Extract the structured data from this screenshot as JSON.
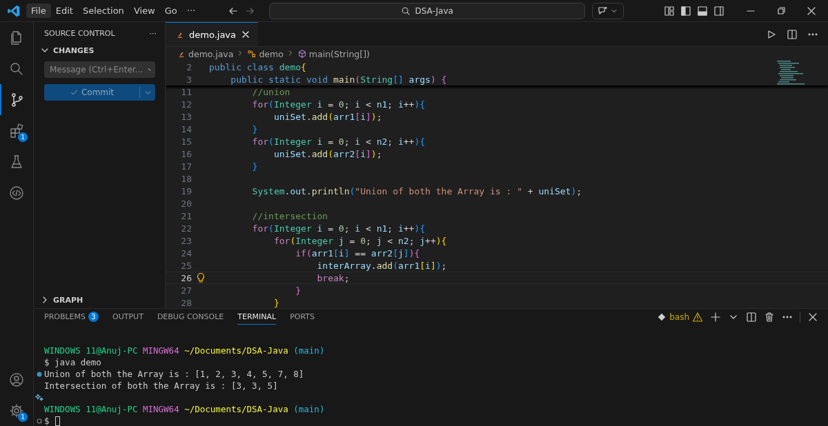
{
  "title_bar": {
    "menu": [
      {
        "label": "File",
        "selected": true
      },
      {
        "label": "Edit",
        "selected": false
      },
      {
        "label": "Selection",
        "selected": false
      },
      {
        "label": "View",
        "selected": false
      },
      {
        "label": "Go",
        "selected": false
      }
    ],
    "more": "···",
    "search": "DSA-Java"
  },
  "activity_bar": {
    "top": [
      {
        "kind": "files",
        "selected": false
      },
      {
        "kind": "search",
        "selected": false
      },
      {
        "kind": "source-control",
        "selected": true
      },
      {
        "kind": "extensions",
        "selected": false,
        "badge": "1"
      },
      {
        "kind": "flask",
        "selected": false
      },
      {
        "kind": "code",
        "selected": false
      }
    ],
    "bottom": [
      {
        "kind": "account",
        "selected": false
      },
      {
        "kind": "gear",
        "selected": false,
        "badge": "1"
      }
    ]
  },
  "sidebar": {
    "title": "SOURCE CONTROL",
    "more": "···",
    "section": "CHANGES",
    "message_placeholder": "Message (Ctrl+Enter...",
    "commit_label": "Commit",
    "graph": "GRAPH"
  },
  "editor": {
    "tab": {
      "label": "demo.java"
    },
    "breadcrumb": [
      {
        "kind": "file",
        "label": "demo.java"
      },
      {
        "kind": "class",
        "label": "demo"
      },
      {
        "kind": "method",
        "label": "main(String[])"
      }
    ],
    "sticky_lines": [
      {
        "number": "2",
        "current": false,
        "tokens": [
          {
            "kind": "kw",
            "text": "public class "
          },
          {
            "kind": "type",
            "text": "demo"
          },
          {
            "kind": "b1",
            "text": "{"
          }
        ]
      },
      {
        "number": "3",
        "current": false,
        "tokens": [
          {
            "kind": "kw",
            "text": "    public static void "
          },
          {
            "kind": "fn",
            "text": "main"
          },
          {
            "kind": "b2",
            "text": "("
          },
          {
            "kind": "type",
            "text": "String"
          },
          {
            "kind": "b3",
            "text": "[]"
          },
          {
            "kind": "var",
            "text": " args"
          },
          {
            "kind": "b2",
            "text": ") {"
          }
        ]
      }
    ],
    "lines": [
      {
        "number": "11",
        "current": false,
        "tokens": [
          {
            "kind": "cm",
            "text": "        //union"
          }
        ]
      },
      {
        "number": "12",
        "current": false,
        "tokens": [
          {
            "kind": "ctrl",
            "text": "        for"
          },
          {
            "kind": "b3",
            "text": "("
          },
          {
            "kind": "type",
            "text": "Integer"
          },
          {
            "kind": "var",
            "text": " i"
          },
          {
            "kind": "p",
            "text": " = "
          },
          {
            "kind": "num",
            "text": "0"
          },
          {
            "kind": "p",
            "text": "; "
          },
          {
            "kind": "var",
            "text": "i"
          },
          {
            "kind": "p",
            "text": " < "
          },
          {
            "kind": "var",
            "text": "n1"
          },
          {
            "kind": "p",
            "text": "; "
          },
          {
            "kind": "var",
            "text": "i"
          },
          {
            "kind": "p",
            "text": "++"
          },
          {
            "kind": "b3",
            "text": "){"
          }
        ]
      },
      {
        "number": "13",
        "current": false,
        "tokens": [
          {
            "kind": "var",
            "text": "            uniSet"
          },
          {
            "kind": "p",
            "text": "."
          },
          {
            "kind": "fn",
            "text": "add"
          },
          {
            "kind": "b1",
            "text": "("
          },
          {
            "kind": "var",
            "text": "arr1"
          },
          {
            "kind": "b2",
            "text": "["
          },
          {
            "kind": "var",
            "text": "i"
          },
          {
            "kind": "b2",
            "text": "]"
          },
          {
            "kind": "b1",
            "text": ")"
          },
          {
            "kind": "p",
            "text": ";"
          }
        ]
      },
      {
        "number": "14",
        "current": false,
        "tokens": [
          {
            "kind": "b3",
            "text": "        }"
          }
        ]
      },
      {
        "number": "15",
        "current": false,
        "tokens": [
          {
            "kind": "ctrl",
            "text": "        for"
          },
          {
            "kind": "b3",
            "text": "("
          },
          {
            "kind": "type",
            "text": "Integer"
          },
          {
            "kind": "var",
            "text": " i"
          },
          {
            "kind": "p",
            "text": " = "
          },
          {
            "kind": "num",
            "text": "0"
          },
          {
            "kind": "p",
            "text": "; "
          },
          {
            "kind": "var",
            "text": "i"
          },
          {
            "kind": "p",
            "text": " < "
          },
          {
            "kind": "var",
            "text": "n2"
          },
          {
            "kind": "p",
            "text": "; "
          },
          {
            "kind": "var",
            "text": "i"
          },
          {
            "kind": "p",
            "text": "++"
          },
          {
            "kind": "b3",
            "text": "){"
          }
        ]
      },
      {
        "number": "16",
        "current": false,
        "tokens": [
          {
            "kind": "var",
            "text": "            uniSet"
          },
          {
            "kind": "p",
            "text": "."
          },
          {
            "kind": "fn",
            "text": "add"
          },
          {
            "kind": "b1",
            "text": "("
          },
          {
            "kind": "var",
            "text": "arr2"
          },
          {
            "kind": "b2",
            "text": "["
          },
          {
            "kind": "var",
            "text": "i"
          },
          {
            "kind": "b2",
            "text": "]"
          },
          {
            "kind": "b1",
            "text": ")"
          },
          {
            "kind": "p",
            "text": ";"
          }
        ]
      },
      {
        "number": "17",
        "current": false,
        "tokens": [
          {
            "kind": "b3",
            "text": "        }"
          }
        ]
      },
      {
        "number": "18",
        "current": false
      },
      {
        "number": "19",
        "current": false,
        "tokens": [
          {
            "kind": "type",
            "text": "        System"
          },
          {
            "kind": "p",
            "text": "."
          },
          {
            "kind": "var",
            "text": "out"
          },
          {
            "kind": "p",
            "text": "."
          },
          {
            "kind": "fn",
            "text": "println"
          },
          {
            "kind": "b3",
            "text": "("
          },
          {
            "kind": "str",
            "text": "\"Union of both the Array is : \""
          },
          {
            "kind": "p",
            "text": " + "
          },
          {
            "kind": "var",
            "text": "uniSet"
          },
          {
            "kind": "b3",
            "text": ")"
          },
          {
            "kind": "p",
            "text": ";"
          }
        ]
      },
      {
        "number": "20",
        "current": false
      },
      {
        "number": "21",
        "current": false,
        "tokens": [
          {
            "kind": "cm",
            "text": "        //intersection"
          }
        ]
      },
      {
        "number": "22",
        "current": false,
        "tokens": [
          {
            "kind": "ctrl",
            "text": "        for"
          },
          {
            "kind": "b3",
            "text": "("
          },
          {
            "kind": "type",
            "text": "Integer"
          },
          {
            "kind": "var",
            "text": " i"
          },
          {
            "kind": "p",
            "text": " = "
          },
          {
            "kind": "num",
            "text": "0"
          },
          {
            "kind": "p",
            "text": "; "
          },
          {
            "kind": "var",
            "text": "i"
          },
          {
            "kind": "p",
            "text": " < "
          },
          {
            "kind": "var",
            "text": "n1"
          },
          {
            "kind": "p",
            "text": "; "
          },
          {
            "kind": "var",
            "text": "i"
          },
          {
            "kind": "p",
            "text": "++"
          },
          {
            "kind": "b3",
            "text": "){"
          }
        ]
      },
      {
        "number": "23",
        "current": false,
        "tokens": [
          {
            "kind": "ctrl",
            "text": "            for"
          },
          {
            "kind": "b1",
            "text": "("
          },
          {
            "kind": "type",
            "text": "Integer"
          },
          {
            "kind": "var",
            "text": " j"
          },
          {
            "kind": "p",
            "text": " = "
          },
          {
            "kind": "num",
            "text": "0"
          },
          {
            "kind": "p",
            "text": "; "
          },
          {
            "kind": "var",
            "text": "j"
          },
          {
            "kind": "p",
            "text": " < "
          },
          {
            "kind": "var",
            "text": "n2"
          },
          {
            "kind": "p",
            "text": "; "
          },
          {
            "kind": "var",
            "text": "j"
          },
          {
            "kind": "p",
            "text": "++"
          },
          {
            "kind": "b1",
            "text": "){"
          }
        ]
      },
      {
        "number": "24",
        "current": false,
        "tokens": [
          {
            "kind": "ctrl",
            "text": "                if"
          },
          {
            "kind": "b2",
            "text": "("
          },
          {
            "kind": "var",
            "text": "arr1"
          },
          {
            "kind": "b3",
            "text": "["
          },
          {
            "kind": "var",
            "text": "i"
          },
          {
            "kind": "b3",
            "text": "]"
          },
          {
            "kind": "p",
            "text": " == "
          },
          {
            "kind": "var",
            "text": "arr2"
          },
          {
            "kind": "b3",
            "text": "["
          },
          {
            "kind": "var",
            "text": "j"
          },
          {
            "kind": "b3",
            "text": "]"
          },
          {
            "kind": "b2",
            "text": "){"
          }
        ]
      },
      {
        "number": "25",
        "current": false,
        "tokens": [
          {
            "kind": "var",
            "text": "                    interArray"
          },
          {
            "kind": "p",
            "text": "."
          },
          {
            "kind": "fn",
            "text": "add"
          },
          {
            "kind": "b3",
            "text": "("
          },
          {
            "kind": "var",
            "text": "arr1"
          },
          {
            "kind": "b1",
            "text": "["
          },
          {
            "kind": "var",
            "text": "i"
          },
          {
            "kind": "b1",
            "text": "]"
          },
          {
            "kind": "b3",
            "text": ")"
          },
          {
            "kind": "p",
            "text": ";"
          }
        ]
      },
      {
        "number": "26",
        "current": true,
        "tokens": [
          {
            "kind": "ctrl",
            "text": "                    break"
          },
          {
            "kind": "p",
            "text": ";"
          }
        ]
      },
      {
        "number": "27",
        "current": false,
        "tokens": [
          {
            "kind": "b2",
            "text": "                }"
          }
        ]
      },
      {
        "number": "28",
        "current": false,
        "tokens": [
          {
            "kind": "b1",
            "text": "            }"
          }
        ]
      }
    ]
  },
  "panel": {
    "tabs": [
      {
        "label": "PROBLEMS",
        "badge": "3",
        "selected": false
      },
      {
        "label": "OUTPUT",
        "selected": false
      },
      {
        "label": "DEBUG CONSOLE",
        "selected": false
      },
      {
        "label": "TERMINAL",
        "selected": true
      },
      {
        "label": "PORTS",
        "selected": false
      }
    ],
    "terminal_name": "bash",
    "terminal": [
      {
        "kind": "prompt",
        "parts": [
          {
            "kind": "user",
            "text": "WINDOWS 11@Anuj-PC"
          },
          {
            "kind": "host",
            "text": " MINGW64"
          },
          {
            "kind": "path",
            "text": " ~/Documents/DSA-Java"
          },
          {
            "kind": "branch",
            "text": " (main)"
          }
        ]
      },
      {
        "kind": "output",
        "parts": [
          {
            "kind": "text",
            "text": "$ java demo"
          }
        ]
      },
      {
        "kind": "output",
        "marker": {
          "kind": "filled"
        },
        "parts": [
          {
            "kind": "text",
            "text": "Union of both the Array is : [1, 2, 3, 4, 5, 7, 8]"
          }
        ]
      },
      {
        "kind": "output",
        "parts": [
          {
            "kind": "text",
            "text": "Intersection of both the Array is : [3, 3, 5]"
          }
        ]
      },
      {
        "kind": "blank",
        "marker": {
          "kind": "sparkle"
        }
      },
      {
        "kind": "prompt",
        "parts": [
          {
            "kind": "user",
            "text": "WINDOWS 11@Anuj-PC"
          },
          {
            "kind": "host",
            "text": " MINGW64"
          },
          {
            "kind": "path",
            "text": " ~/Documents/DSA-Java"
          },
          {
            "kind": "branch",
            "text": " (main)"
          }
        ]
      },
      {
        "kind": "input",
        "marker": {
          "kind": "hollow"
        },
        "parts": [
          {
            "kind": "text",
            "text": "$"
          }
        ]
      }
    ]
  }
}
